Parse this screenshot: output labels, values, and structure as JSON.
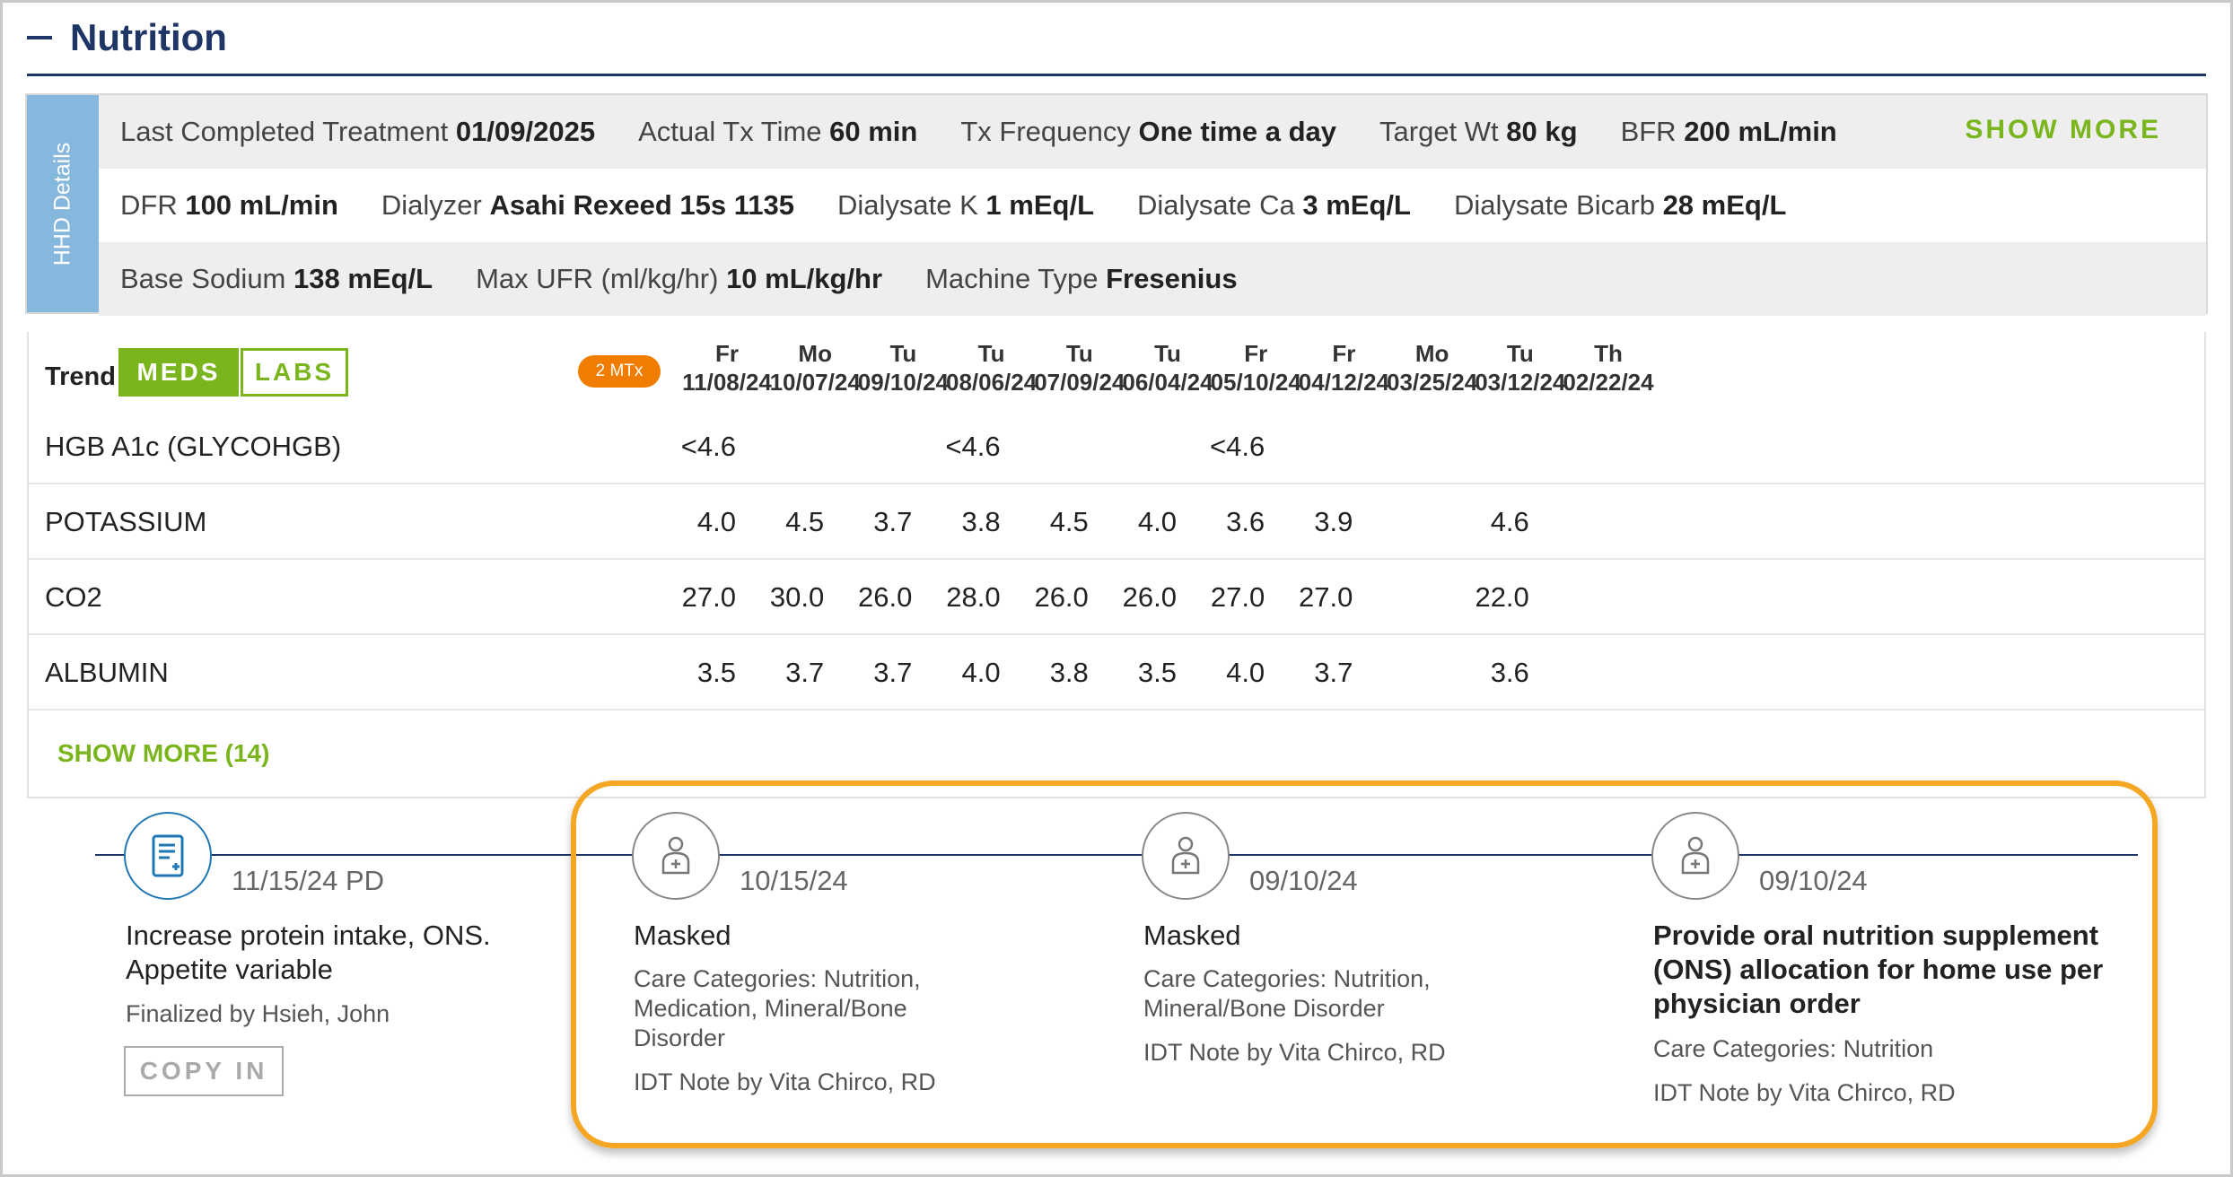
{
  "section": {
    "title": "Nutrition",
    "collapse_icon": "minus-icon"
  },
  "hhd": {
    "tab_label": "HHD Details",
    "show_more": "SHOW MORE",
    "rows": [
      [
        {
          "label": "Last Completed Treatment",
          "value": "01/09/2025"
        },
        {
          "label": "Actual Tx Time",
          "value": "60 min"
        },
        {
          "label": "Tx Frequency",
          "value": "One time a day"
        },
        {
          "label": "Target Wt",
          "value": "80 kg"
        },
        {
          "label": "BFR",
          "value": "200 mL/min"
        }
      ],
      [
        {
          "label": "DFR",
          "value": "100 mL/min"
        },
        {
          "label": "Dialyzer",
          "value": "Asahi Rexeed 15s 1135"
        },
        {
          "label": "Dialysate K",
          "value": "1 mEq/L"
        },
        {
          "label": "Dialysate Ca",
          "value": "3 mEq/L"
        },
        {
          "label": "Dialysate Bicarb",
          "value": "28 mEq/L"
        }
      ],
      [
        {
          "label": "Base Sodium",
          "value": "138 mEq/L"
        },
        {
          "label": "Max UFR (ml/kg/hr)",
          "value": "10 mL/kg/hr"
        },
        {
          "label": "Machine Type",
          "value": "Fresenius"
        }
      ]
    ]
  },
  "trend": {
    "label": "Trend",
    "meds_label": "MEDS",
    "labs_label": "LABS",
    "mtx_badge": "2 MTx",
    "dates": [
      {
        "day": "Fr",
        "date": "11/08/24"
      },
      {
        "day": "Mo",
        "date": "10/07/24"
      },
      {
        "day": "Tu",
        "date": "09/10/24"
      },
      {
        "day": "Tu",
        "date": "08/06/24"
      },
      {
        "day": "Tu",
        "date": "07/09/24"
      },
      {
        "day": "Tu",
        "date": "06/04/24"
      },
      {
        "day": "Fr",
        "date": "05/10/24"
      },
      {
        "day": "Fr",
        "date": "04/12/24"
      },
      {
        "day": "Mo",
        "date": "03/25/24"
      },
      {
        "day": "Tu",
        "date": "03/12/24"
      },
      {
        "day": "Th",
        "date": "02/22/24"
      }
    ],
    "rows": [
      {
        "name": "HGB A1c (GLYCOHGB)",
        "values": [
          "<4.6",
          "",
          "",
          "<4.6",
          "",
          "",
          "<4.6",
          "",
          "",
          "",
          ""
        ]
      },
      {
        "name": "POTASSIUM",
        "values": [
          "4.0",
          "4.5",
          "3.7",
          "3.8",
          "4.5",
          "4.0",
          "3.6",
          "3.9",
          "",
          "4.6",
          ""
        ]
      },
      {
        "name": "CO2",
        "values": [
          "27.0",
          "30.0",
          "26.0",
          "28.0",
          "26.0",
          "26.0",
          "27.0",
          "27.0",
          "",
          "22.0",
          ""
        ]
      },
      {
        "name": "ALBUMIN",
        "values": [
          "3.5",
          "3.7",
          "3.7",
          "4.0",
          "3.8",
          "3.5",
          "4.0",
          "3.7",
          "",
          "3.6",
          ""
        ]
      }
    ],
    "show_more": "SHOW MORE (14)"
  },
  "timeline": {
    "items": [
      {
        "icon": "document-icon",
        "date": "11/15/24 PD",
        "title_lines": [
          "Increase protein intake, ONS.",
          "Appetite variable"
        ],
        "bold": false,
        "sub": [
          "Finalized by Hsieh, John"
        ],
        "copy_label": "COPY IN"
      },
      {
        "icon": "care-provider-icon",
        "date": "10/15/24",
        "title_lines": [
          "Masked"
        ],
        "bold": false,
        "sub": [
          "Care Categories: Nutrition,",
          "Medication, Mineral/Bone",
          "Disorder"
        ],
        "note": "IDT Note by Vita Chirco, RD"
      },
      {
        "icon": "care-provider-icon",
        "date": "09/10/24",
        "title_lines": [
          "Masked"
        ],
        "bold": false,
        "sub": [
          "Care Categories: Nutrition,",
          "Mineral/Bone Disorder"
        ],
        "note": "IDT Note by Vita Chirco, RD"
      },
      {
        "icon": "care-provider-icon",
        "date": "09/10/24",
        "title_lines": [
          "Provide oral nutrition supplement",
          "(ONS) allocation for home use per",
          "physician order"
        ],
        "bold": true,
        "sub": [
          "Care Categories: Nutrition"
        ],
        "note": "IDT Note by Vita Chirco, RD"
      }
    ]
  },
  "colors": {
    "navy": "#1f3566",
    "green": "#7ab51d",
    "orange": "#f07c00",
    "highlight": "#f5a623",
    "tab_blue": "#86b7dc"
  }
}
